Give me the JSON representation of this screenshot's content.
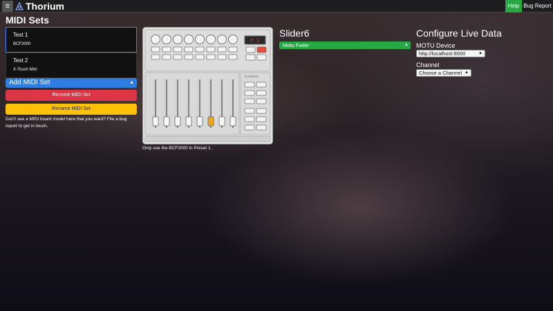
{
  "header": {
    "app_name": "Thorium",
    "help_label": "Help",
    "bug_label": "Bug Report"
  },
  "midi_sets": {
    "title": "MIDI Sets",
    "items": [
      {
        "name": "Test 1",
        "model": "BCF2000",
        "active": true
      },
      {
        "name": "Test 2",
        "model": "X-Touch Mini",
        "active": false
      }
    ],
    "add_select_label": "Add MIDI Set",
    "remove_label": "Remove MIDI Set",
    "rename_label": "Rename MIDI Set",
    "hint": "Don't see a MIDI board model here that you want? File a bug report to get in touch."
  },
  "device": {
    "note": "Only use the BCF2000 in Preset 1.",
    "display_text": "P 1",
    "selected_fader": 6
  },
  "slider": {
    "title": "Slider6",
    "component": "Motu Fader"
  },
  "live_data": {
    "title": "Configure Live Data",
    "device_label": "MOTU Device",
    "device_value": "http://localhost:6000",
    "channel_label": "Channel",
    "channel_value": "Choose a Channel"
  },
  "colors": {
    "accent_blue": "#2f7de1",
    "danger": "#dc3545",
    "warning": "#ffc107",
    "success": "#28a745",
    "fader_selected": "#f2a81d",
    "device_red_button": "#e8493b"
  }
}
